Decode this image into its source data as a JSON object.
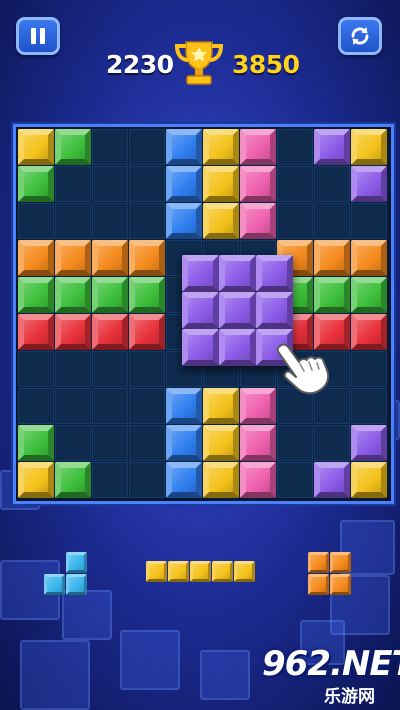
{
  "colors": {
    "yellow": "#f4c21a",
    "green": "#3cbf3a",
    "blue": "#2f7ef0",
    "pink": "#ef5fae",
    "purple": "#8b5ae8",
    "orange": "#f58a1c",
    "red": "#e8303a",
    "cyan": "#3ab6ee",
    "gold": "#ffd21e"
  },
  "hud": {
    "pause_icon": "pause-icon",
    "restart_icon": "restart-icon",
    "current_score": "2230",
    "best_score": "3850",
    "trophy_icon": "trophy-icon"
  },
  "board": {
    "size": 10,
    "cells": [
      {
        "r": 0,
        "c": 0,
        "color": "yellow"
      },
      {
        "r": 0,
        "c": 1,
        "color": "green"
      },
      {
        "r": 0,
        "c": 4,
        "color": "blue"
      },
      {
        "r": 0,
        "c": 5,
        "color": "yellow"
      },
      {
        "r": 0,
        "c": 6,
        "color": "pink"
      },
      {
        "r": 0,
        "c": 8,
        "color": "purple"
      },
      {
        "r": 0,
        "c": 9,
        "color": "yellow"
      },
      {
        "r": 1,
        "c": 0,
        "color": "green"
      },
      {
        "r": 1,
        "c": 4,
        "color": "blue"
      },
      {
        "r": 1,
        "c": 5,
        "color": "yellow"
      },
      {
        "r": 1,
        "c": 6,
        "color": "pink"
      },
      {
        "r": 1,
        "c": 9,
        "color": "purple"
      },
      {
        "r": 2,
        "c": 4,
        "color": "blue"
      },
      {
        "r": 2,
        "c": 5,
        "color": "yellow"
      },
      {
        "r": 2,
        "c": 6,
        "color": "pink"
      },
      {
        "r": 3,
        "c": 0,
        "color": "orange"
      },
      {
        "r": 3,
        "c": 1,
        "color": "orange"
      },
      {
        "r": 3,
        "c": 2,
        "color": "orange"
      },
      {
        "r": 3,
        "c": 3,
        "color": "orange"
      },
      {
        "r": 3,
        "c": 7,
        "color": "orange"
      },
      {
        "r": 3,
        "c": 8,
        "color": "orange"
      },
      {
        "r": 3,
        "c": 9,
        "color": "orange"
      },
      {
        "r": 4,
        "c": 0,
        "color": "green"
      },
      {
        "r": 4,
        "c": 1,
        "color": "green"
      },
      {
        "r": 4,
        "c": 2,
        "color": "green"
      },
      {
        "r": 4,
        "c": 3,
        "color": "green"
      },
      {
        "r": 4,
        "c": 7,
        "color": "green"
      },
      {
        "r": 4,
        "c": 8,
        "color": "green"
      },
      {
        "r": 4,
        "c": 9,
        "color": "green"
      },
      {
        "r": 5,
        "c": 0,
        "color": "red"
      },
      {
        "r": 5,
        "c": 1,
        "color": "red"
      },
      {
        "r": 5,
        "c": 2,
        "color": "red"
      },
      {
        "r": 5,
        "c": 3,
        "color": "red"
      },
      {
        "r": 5,
        "c": 7,
        "color": "red"
      },
      {
        "r": 5,
        "c": 8,
        "color": "red"
      },
      {
        "r": 5,
        "c": 9,
        "color": "red"
      },
      {
        "r": 7,
        "c": 4,
        "color": "blue"
      },
      {
        "r": 7,
        "c": 5,
        "color": "yellow"
      },
      {
        "r": 7,
        "c": 6,
        "color": "pink"
      },
      {
        "r": 8,
        "c": 0,
        "color": "green"
      },
      {
        "r": 8,
        "c": 4,
        "color": "blue"
      },
      {
        "r": 8,
        "c": 5,
        "color": "yellow"
      },
      {
        "r": 8,
        "c": 6,
        "color": "pink"
      },
      {
        "r": 8,
        "c": 9,
        "color": "purple"
      },
      {
        "r": 9,
        "c": 0,
        "color": "yellow"
      },
      {
        "r": 9,
        "c": 1,
        "color": "green"
      },
      {
        "r": 9,
        "c": 4,
        "color": "blue"
      },
      {
        "r": 9,
        "c": 5,
        "color": "yellow"
      },
      {
        "r": 9,
        "c": 6,
        "color": "pink"
      },
      {
        "r": 9,
        "c": 8,
        "color": "purple"
      },
      {
        "r": 9,
        "c": 9,
        "color": "yellow"
      }
    ]
  },
  "dragged_piece": {
    "color": "purple",
    "shape": [
      [
        1,
        1,
        1
      ],
      [
        1,
        1,
        1
      ],
      [
        1,
        1,
        1
      ]
    ],
    "hand_icon": "pointing-hand-icon"
  },
  "tray": [
    {
      "name": "tray-piece-l",
      "color": "cyan",
      "shape": [
        [
          0,
          1
        ],
        [
          1,
          1
        ]
      ]
    },
    {
      "name": "tray-piece-bar",
      "color": "yellow",
      "shape": [
        [
          1,
          1,
          1,
          1,
          1
        ]
      ]
    },
    {
      "name": "tray-piece-square",
      "color": "orange",
      "shape": [
        [
          1,
          1
        ],
        [
          1,
          1
        ]
      ]
    }
  ],
  "watermark": {
    "main": "962.NET",
    "sub": "乐游网"
  }
}
